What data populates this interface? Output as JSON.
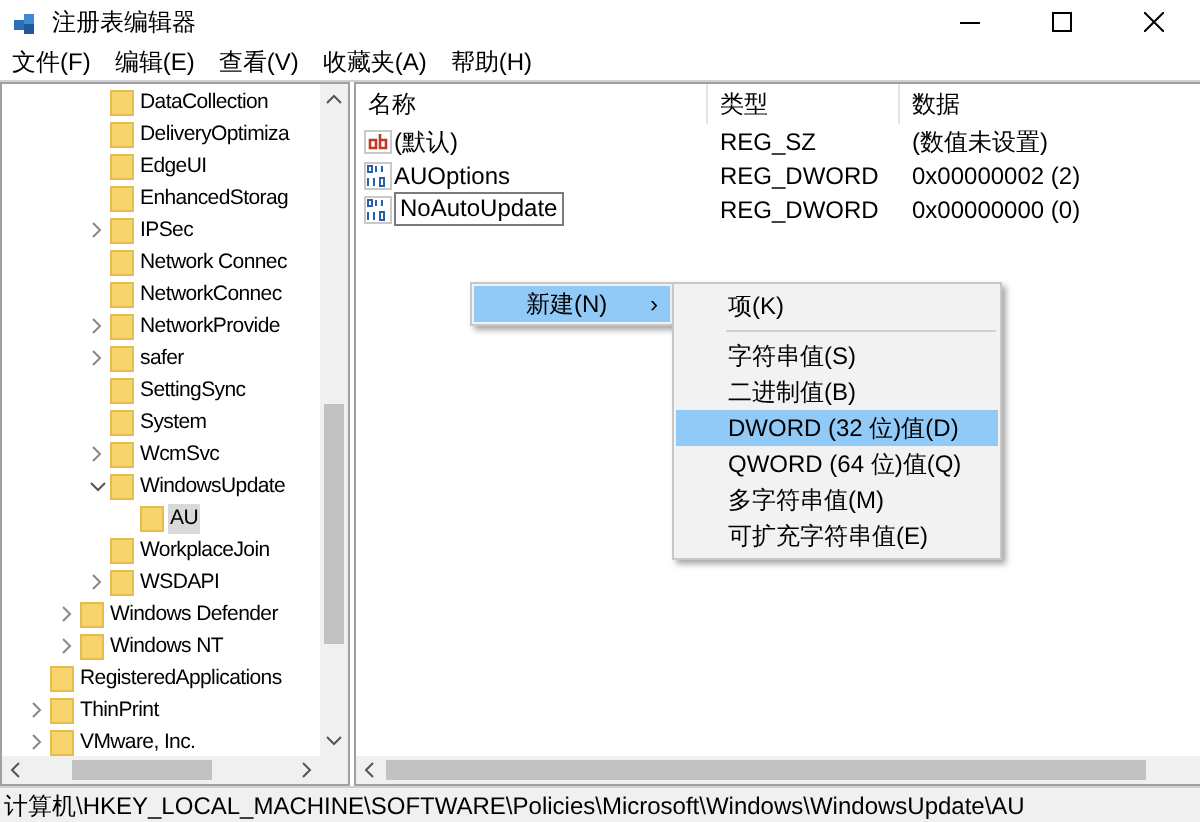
{
  "window": {
    "title": "注册表编辑器"
  },
  "menu_bar": [
    "文件(F)",
    "编辑(E)",
    "查看(V)",
    "收藏夹(A)",
    "帮助(H)"
  ],
  "tree": {
    "items": [
      {
        "children": [
          {
            "children": [
              {
                "label": "DataCollection",
                "selected": false
              },
              {
                "label": "DeliveryOptimiza",
                "selected": false
              },
              {
                "label": "EdgeUI",
                "selected": false
              },
              {
                "label": "EnhancedStorag",
                "selected": false
              },
              {
                "label": "IPSec",
                "selected": false,
                "expanded": false
              },
              {
                "label": "Network Connec",
                "selected": false
              },
              {
                "label": "NetworkConnec",
                "selected": false
              },
              {
                "label": "NetworkProvide",
                "selected": false,
                "expanded": false
              },
              {
                "label": "safer",
                "selected": false,
                "expanded": false
              },
              {
                "label": "SettingSync",
                "selected": false
              },
              {
                "label": "System",
                "selected": false
              },
              {
                "label": "WcmSvc",
                "selected": false,
                "expanded": false
              },
              {
                "label": "WindowsUpdate",
                "selected": false,
                "expanded": true,
                "children": [
                  {
                    "label": "AU",
                    "selected": true
                  }
                ]
              },
              {
                "label": "WorkplaceJoin",
                "selected": false
              },
              {
                "label": "WSDAPI",
                "selected": false,
                "expanded": false
              }
            ]
          },
          {
            "label": "Windows Defender",
            "selected": false,
            "expanded": false
          },
          {
            "label": "Windows NT",
            "selected": false,
            "expanded": false
          }
        ]
      },
      {
        "label": "RegisteredApplications",
        "selected": false
      },
      {
        "label": "ThinPrint",
        "selected": false,
        "expanded": false
      },
      {
        "label": "VMware, Inc.",
        "selected": false,
        "expanded": false
      }
    ]
  },
  "values_list": {
    "columns": [
      "名称",
      "类型",
      "数据"
    ],
    "rows": [
      {
        "kind": "string",
        "name": "(默认)",
        "type": "REG_SZ",
        "data": "(数值未设置)",
        "editing": false
      },
      {
        "kind": "binary",
        "name": "AUOptions",
        "type": "REG_DWORD",
        "data": "0x00000002 (2)",
        "editing": false
      },
      {
        "kind": "binary",
        "name": "NoAutoUpdate",
        "type": "REG_DWORD",
        "data": "0x00000000 (0)",
        "editing": true
      }
    ]
  },
  "context_menu": {
    "items": [
      {
        "label": "新建(N)",
        "arrow": "›",
        "selected": true
      }
    ]
  },
  "submenu": {
    "items": [
      {
        "kind": "item",
        "label": "项(K)",
        "selected": false
      },
      {
        "kind": "separator"
      },
      {
        "kind": "item",
        "label": "字符串值(S)",
        "selected": false
      },
      {
        "kind": "item",
        "label": "二进制值(B)",
        "selected": false
      },
      {
        "kind": "item",
        "label": "DWORD (32 位)值(D)",
        "selected": true
      },
      {
        "kind": "item",
        "label": "QWORD (64 位)值(Q)",
        "selected": false
      },
      {
        "kind": "item",
        "label": "多字符串值(M)",
        "selected": false
      },
      {
        "kind": "item",
        "label": "可扩充字符串值(E)",
        "selected": false
      }
    ]
  },
  "status_bar": "计算机\\HKEY_LOCAL_MACHINE\\SOFTWARE\\Policies\\Microsoft\\Windows\\WindowsUpdate\\AU"
}
